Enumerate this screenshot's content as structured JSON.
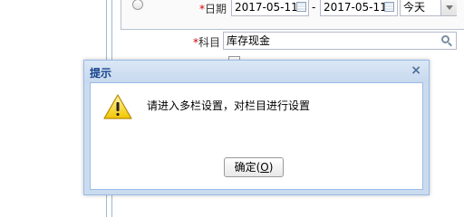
{
  "form": {
    "date_label": "日期",
    "date_required": "*",
    "date_start": "2017-05-11",
    "date_dash": "-",
    "date_end": "2017-05-11",
    "period_value": "今天",
    "subject_required": "*",
    "subject_label": "科目",
    "subject_value": "库存现金"
  },
  "dialog": {
    "title": "提示",
    "close_glyph": "×",
    "message": "请进入多栏设置，对栏目进行设置",
    "ok_label": "确定(",
    "ok_mnemonic": "O",
    "ok_suffix": ")"
  }
}
